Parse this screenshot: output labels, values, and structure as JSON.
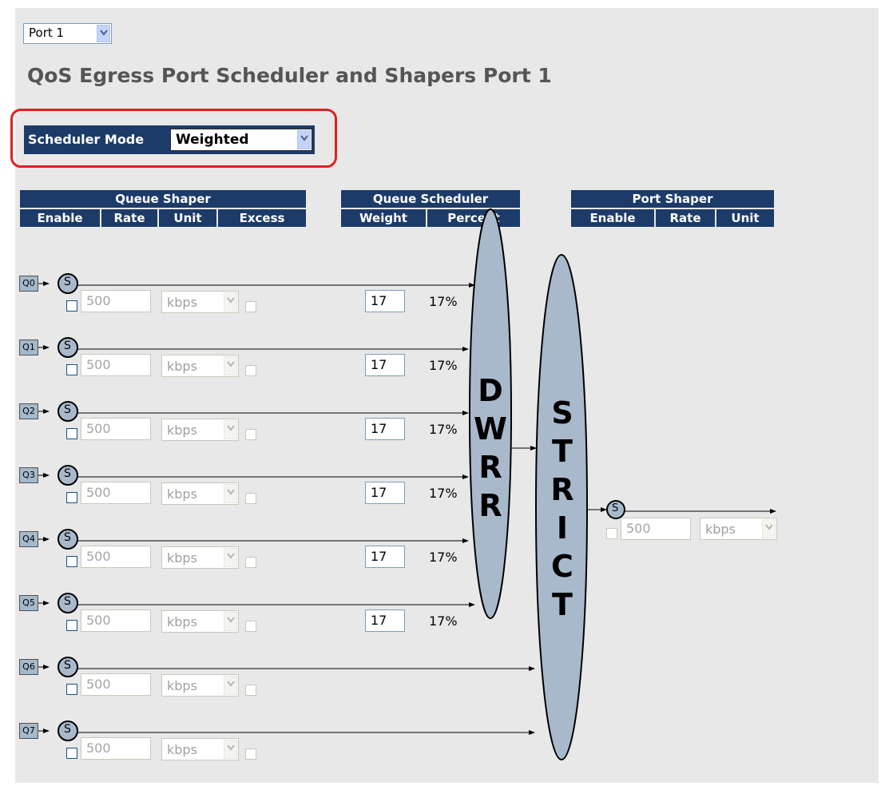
{
  "port_select": {
    "value": "Port 1"
  },
  "title": "QoS Egress Port Scheduler and Shapers  Port 1",
  "scheduler": {
    "label": "Scheduler Mode",
    "value": "Weighted"
  },
  "headers": {
    "queue_shaper": {
      "title": "Queue Shaper",
      "cols": [
        "Enable",
        "Rate",
        "Unit",
        "Excess"
      ]
    },
    "queue_scheduler": {
      "title": "Queue Scheduler",
      "cols": [
        "Weight",
        "Percent"
      ]
    },
    "port_shaper": {
      "title": "Port Shaper",
      "cols": [
        "Enable",
        "Rate",
        "Unit"
      ]
    }
  },
  "queues": [
    {
      "label": "Q0",
      "shaper": "S",
      "rate": "500",
      "unit": "kbps",
      "weight": "17",
      "percent": "17%"
    },
    {
      "label": "Q1",
      "shaper": "S",
      "rate": "500",
      "unit": "kbps",
      "weight": "17",
      "percent": "17%"
    },
    {
      "label": "Q2",
      "shaper": "S",
      "rate": "500",
      "unit": "kbps",
      "weight": "17",
      "percent": "17%"
    },
    {
      "label": "Q3",
      "shaper": "S",
      "rate": "500",
      "unit": "kbps",
      "weight": "17",
      "percent": "17%"
    },
    {
      "label": "Q4",
      "shaper": "S",
      "rate": "500",
      "unit": "kbps",
      "weight": "17",
      "percent": "17%"
    },
    {
      "label": "Q5",
      "shaper": "S",
      "rate": "500",
      "unit": "kbps",
      "weight": "17",
      "percent": "17%"
    },
    {
      "label": "Q6",
      "shaper": "S",
      "rate": "500",
      "unit": "kbps"
    },
    {
      "label": "Q7",
      "shaper": "S",
      "rate": "500",
      "unit": "kbps"
    }
  ],
  "dwrr": {
    "letters": [
      "D",
      "W",
      "R",
      "R"
    ]
  },
  "strict": {
    "letters": [
      "S",
      "T",
      "R",
      "I",
      "C",
      "T"
    ]
  },
  "port_shaper": {
    "shaper": "S",
    "rate": "500",
    "unit": "kbps"
  },
  "colors": {
    "header_bg": "#1c3b69",
    "ellipse_fill": "#a9b9cc",
    "highlight": "#e02020",
    "page_bg": "#e8e8e8"
  }
}
